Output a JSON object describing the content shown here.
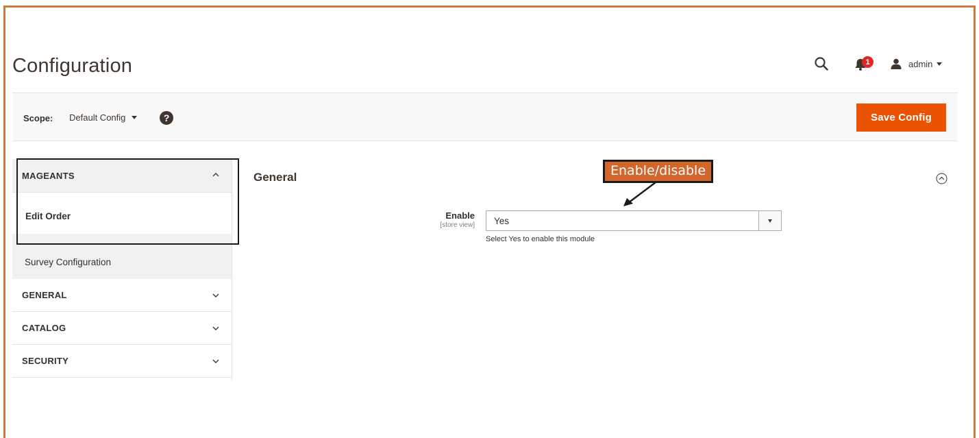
{
  "page": {
    "title": "Configuration"
  },
  "header": {
    "notifications_count": "1",
    "user_name": "admin"
  },
  "scope": {
    "label": "Scope:",
    "value": "Default Config",
    "help_glyph": "?"
  },
  "actions": {
    "save_label": "Save Config"
  },
  "sidebar": {
    "group": {
      "label": "MAGEANTS",
      "items": [
        {
          "label": "Edit Order",
          "active": true
        },
        {
          "label": "Survey Configuration",
          "active": false
        }
      ]
    },
    "tabs": [
      {
        "label": "GENERAL"
      },
      {
        "label": "CATALOG"
      },
      {
        "label": "SECURITY"
      }
    ]
  },
  "section": {
    "title": "General",
    "field": {
      "label": "Enable",
      "scope_note": "[store view]",
      "value": "Yes",
      "note": "Select Yes to enable this module"
    }
  },
  "annotation": {
    "text": "Enable/disable"
  },
  "colors": {
    "accent": "#eb5202",
    "annotation_fill": "#d2672e",
    "frame_border": "#d2783a",
    "badge": "#e22626"
  }
}
